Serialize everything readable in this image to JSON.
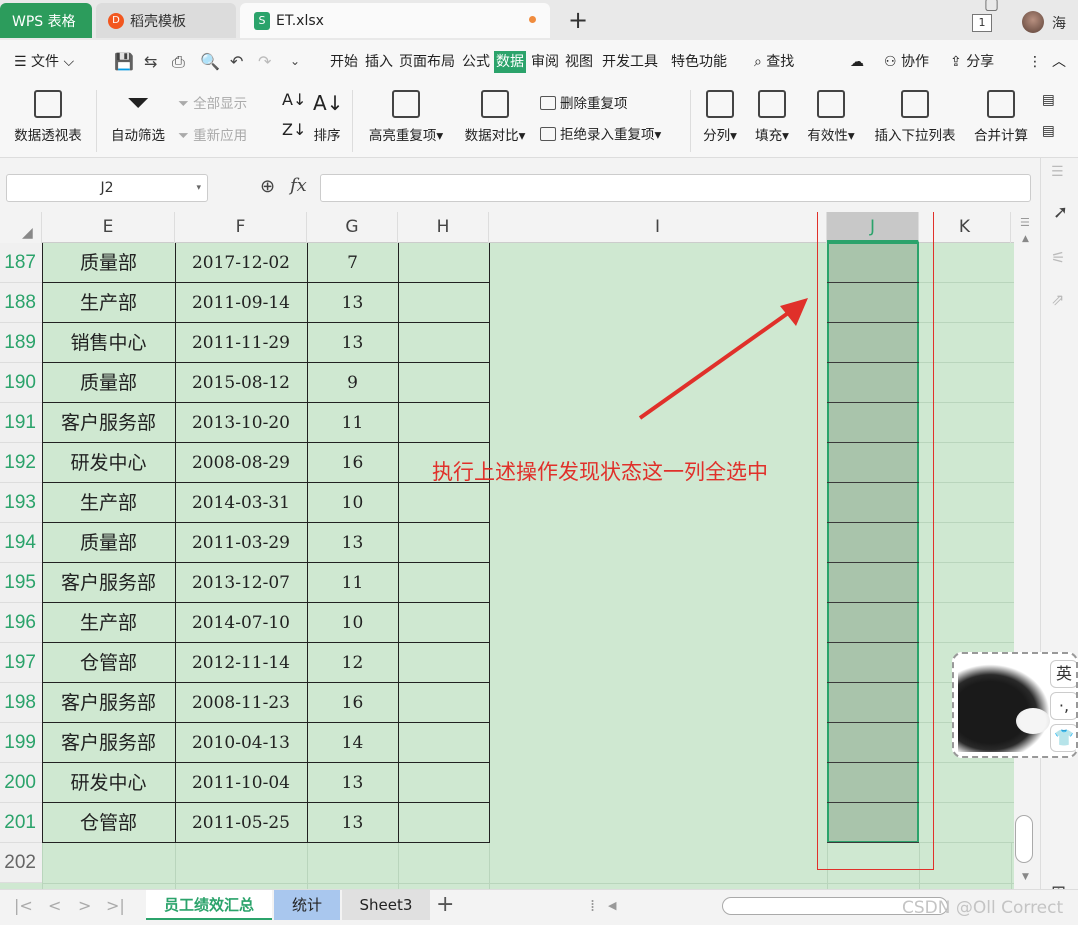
{
  "tabs": {
    "wps": "WPS 表格",
    "template": "稻壳模板",
    "document": "ET.xlsx",
    "window_badge": "1",
    "user": "海"
  },
  "menu": {
    "file": "文件",
    "items": [
      "开始",
      "插入",
      "页面布局",
      "公式",
      "数据",
      "审阅",
      "视图",
      "开发工具",
      "特色功能"
    ],
    "search": "查找",
    "collaborate": "协作",
    "share": "分享"
  },
  "ribbon": {
    "pivot": "数据透视表",
    "autofilter": "自动筛选",
    "show_all": "全部显示",
    "reapply": "重新应用",
    "sort": "排序",
    "highlight_dup": "高亮重复项",
    "compare": "数据对比",
    "remove_dup": "删除重复项",
    "reject_dup": "拒绝录入重复项",
    "split": "分列",
    "fill": "填充",
    "validity": "有效性",
    "insert_dropdown": "插入下拉列表",
    "merge_calc": "合并计算"
  },
  "formula_bar": {
    "name_box": "J2",
    "fx": "fx",
    "formula": ""
  },
  "columns": [
    "E",
    "F",
    "G",
    "H",
    "I",
    "J",
    "K"
  ],
  "rows": [
    {
      "num": "187",
      "dept": "质量部",
      "date": "2017-12-02",
      "val": "7"
    },
    {
      "num": "188",
      "dept": "生产部",
      "date": "2011-09-14",
      "val": "13"
    },
    {
      "num": "189",
      "dept": "销售中心",
      "date": "2011-11-29",
      "val": "13"
    },
    {
      "num": "190",
      "dept": "质量部",
      "date": "2015-08-12",
      "val": "9"
    },
    {
      "num": "191",
      "dept": "客户服务部",
      "date": "2013-10-20",
      "val": "11"
    },
    {
      "num": "192",
      "dept": "研发中心",
      "date": "2008-08-29",
      "val": "16"
    },
    {
      "num": "193",
      "dept": "生产部",
      "date": "2014-03-31",
      "val": "10"
    },
    {
      "num": "194",
      "dept": "质量部",
      "date": "2011-03-29",
      "val": "13"
    },
    {
      "num": "195",
      "dept": "客户服务部",
      "date": "2013-12-07",
      "val": "11"
    },
    {
      "num": "196",
      "dept": "生产部",
      "date": "2014-07-10",
      "val": "10"
    },
    {
      "num": "197",
      "dept": "仓管部",
      "date": "2012-11-14",
      "val": "12"
    },
    {
      "num": "198",
      "dept": "客户服务部",
      "date": "2008-11-23",
      "val": "16"
    },
    {
      "num": "199",
      "dept": "客户服务部",
      "date": "2010-04-13",
      "val": "14"
    },
    {
      "num": "200",
      "dept": "研发中心",
      "date": "2011-10-04",
      "val": "13"
    },
    {
      "num": "201",
      "dept": "仓管部",
      "date": "2011-05-25",
      "val": "13"
    }
  ],
  "empty_row": "202",
  "annotation": "执行上述操作发现状态这一列全选中",
  "ime": {
    "lang": "英",
    "punct": "·,",
    "skin": "👕"
  },
  "sheet_tabs": [
    "员工绩效汇总",
    "统计",
    "Sheet3"
  ],
  "watermark": "CSDN @Oll Correct",
  "colors": {
    "accent": "#2ba36b",
    "annotation": "#e0302a",
    "cell_bg": "#cfe8d1",
    "selection": "#a9c4ab"
  }
}
